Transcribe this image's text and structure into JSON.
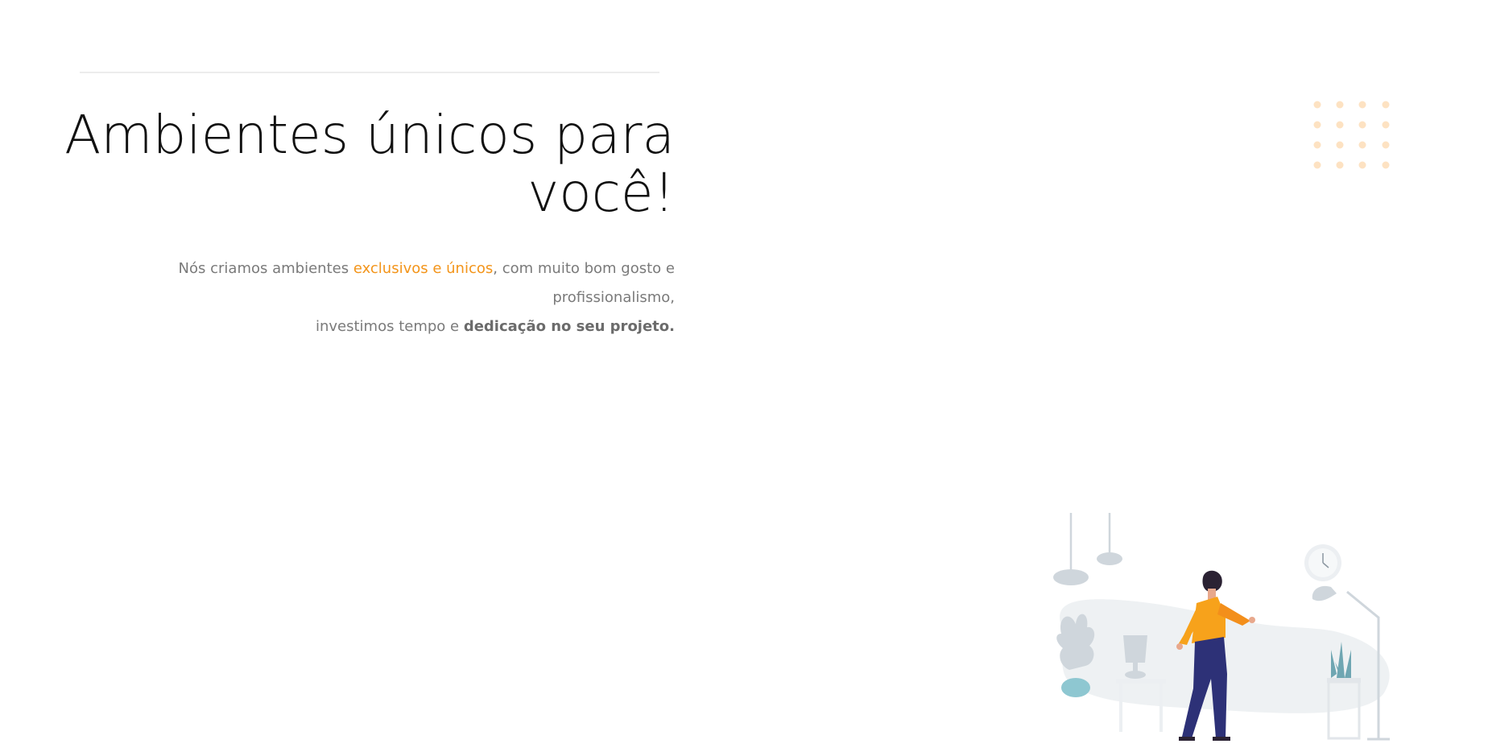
{
  "hero": {
    "title_line1": "Ambientes únicos para",
    "title_line2": "você!",
    "text_part1": "Nós criamos ambientes ",
    "text_accent": "exclusivos e únicos",
    "text_part2": ", com muito bom gosto e profissionalismo,",
    "text_part3": "investimos tempo e ",
    "text_strong": "dedicação no seu projeto."
  },
  "colors": {
    "accent": "#f39419",
    "dots": "#fde2c2",
    "illustration_grey": "#cfd6dc",
    "person_jacket": "#f7a21b",
    "person_pants": "#2d3177"
  },
  "decor": {
    "dots_icon": "dot-grid-icon",
    "illustration_icon": "living-room-illustration"
  }
}
